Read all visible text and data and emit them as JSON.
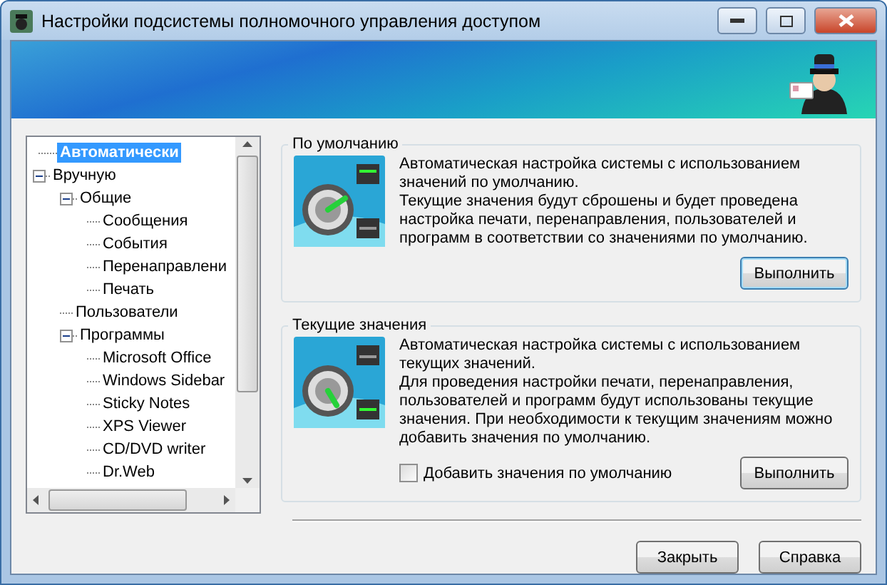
{
  "window": {
    "title": "Настройки подсистемы полномочного управления доступом"
  },
  "tree": [
    {
      "label": "Автоматически",
      "selected": true
    },
    {
      "label": "Вручную",
      "selected": false,
      "expanded": true,
      "children": [
        {
          "label": "Общие",
          "selected": false,
          "expanded": true,
          "children": [
            {
              "label": "Сообщения",
              "selected": false
            },
            {
              "label": "События",
              "selected": false
            },
            {
              "label": "Перенаправлени",
              "selected": false
            },
            {
              "label": "Печать",
              "selected": false
            }
          ]
        },
        {
          "label": "Пользователи",
          "selected": false
        },
        {
          "label": "Программы",
          "selected": false,
          "expanded": true,
          "children": [
            {
              "label": "Microsoft Office",
              "selected": false
            },
            {
              "label": "Windows Sidebar",
              "selected": false
            },
            {
              "label": "Sticky Notes",
              "selected": false
            },
            {
              "label": "XPS Viewer",
              "selected": false
            },
            {
              "label": "CD/DVD writer",
              "selected": false
            },
            {
              "label": "Dr.Web",
              "selected": false
            }
          ]
        }
      ]
    }
  ],
  "groups": [
    {
      "title": "По умолчанию",
      "paragraphs": [
        "Автоматическая настройка системы с использованием значений по умолчанию.",
        "Текущие значения будут сброшены и будет проведена настройка печати, перенаправления, пользователей и программ в соответствии со значениями по умолчанию."
      ],
      "button": "Выполнить"
    },
    {
      "title": "Текущие значения",
      "paragraphs": [
        "Автоматическая настройка системы с использованием текущих значений.",
        "Для проведения настройки печати, перенаправления, пользователей и программ будут использованы текущие значения. При необходимости к текущим значениям можно добавить значения по умолчанию."
      ],
      "checkbox": {
        "label": "Добавить значения по умолчанию",
        "checked": false
      },
      "button": "Выполнить"
    }
  ],
  "buttons": [
    "Закрыть",
    "Справка"
  ]
}
